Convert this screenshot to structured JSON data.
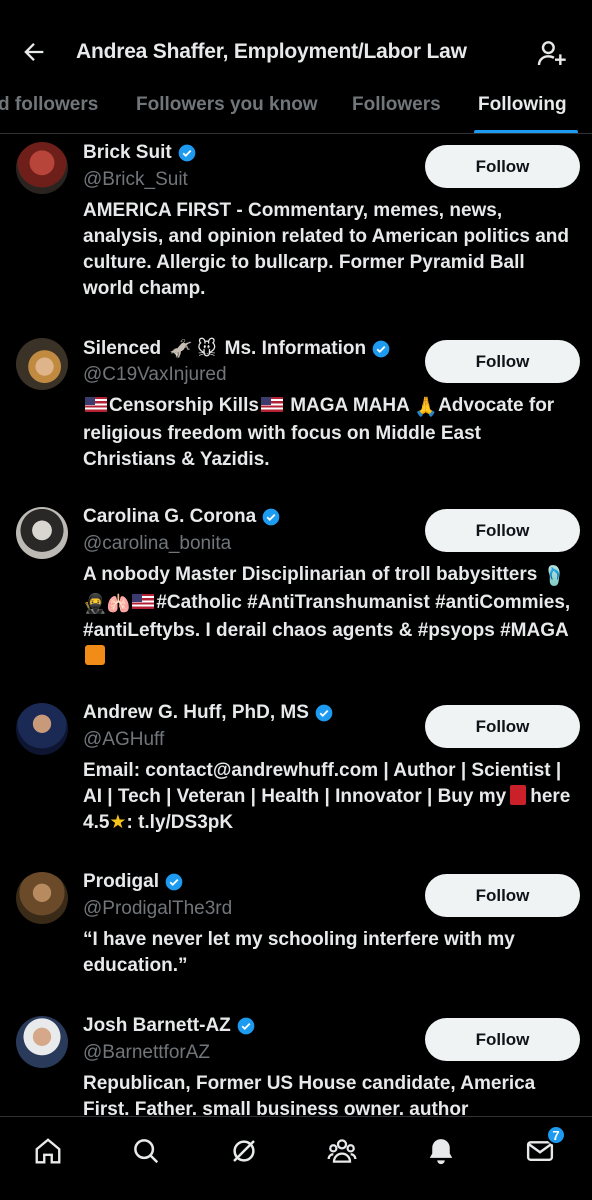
{
  "header": {
    "title": "Andrea Shaffer, Employment/Labor Law",
    "back_icon": "arrow-left-icon",
    "add_user_icon": "add-user-icon"
  },
  "tabs": [
    {
      "label": "d followers"
    },
    {
      "label": "Followers you know"
    },
    {
      "label": "Followers"
    },
    {
      "label": "Following",
      "active": true
    }
  ],
  "users": [
    {
      "name": "Brick Suit",
      "handle": "@Brick_Suit",
      "bio": "AMERICA FIRST - Commentary, memes, news, analysis, and opinion related to American politics and culture. Allergic to bullcarp. Former Pyramid Ball world champ.",
      "follow_label": "Follow",
      "verified": true
    },
    {
      "name": "Silenced",
      "name_suffix": "Ms. Information",
      "handle": "@C19VaxInjured",
      "bio_parts": [
        "Censorship Kills",
        " MAGA MAHA ",
        "Advocate for religious freedom with focus on Middle East Christians & Yazidis."
      ],
      "follow_label": "Follow",
      "verified": true
    },
    {
      "name": "Carolina G. Corona",
      "handle": "@carolina_bonita",
      "bio_parts": [
        "A nobody Master Disciplinarian of troll babysitters",
        "#Catholic #AntiTranshumanist #antiCommies, #antiLeftybs. I derail chaos agents & #psyops #MAGA"
      ],
      "follow_label": "Follow",
      "verified": true
    },
    {
      "name": "Andrew G. Huff, PhD, MS",
      "handle": "@AGHuff",
      "bio_parts": [
        "Email: contact@andrewhuff.com | Author | Scientist | AI | Tech | Veteran | Health | Innovator | Buy my",
        "here 4.5",
        ": t.ly/DS3pK"
      ],
      "follow_label": "Follow",
      "verified": true
    },
    {
      "name": "Prodigal",
      "handle": "@ProdigalThe3rd",
      "bio": "“I have never let my schooling interfere with my education.”",
      "follow_label": "Follow",
      "verified": true
    },
    {
      "name": "Josh Barnett-AZ",
      "handle": "@BarnettforAZ",
      "bio": "Republican, Former US House candidate, America First, Father, small business owner, author",
      "follow_label": "Follow",
      "verified": true
    }
  ],
  "bottom_nav": {
    "items": [
      "home-icon",
      "search-icon",
      "grok-icon",
      "communities-icon",
      "notifications-icon",
      "messages-icon"
    ],
    "messages_badge": "7"
  },
  "colors": {
    "background": "#000000",
    "accent": "#1d9bf0",
    "text_primary": "#e7e9ea",
    "text_secondary": "#71767b",
    "button_bg": "#eff3f4"
  }
}
